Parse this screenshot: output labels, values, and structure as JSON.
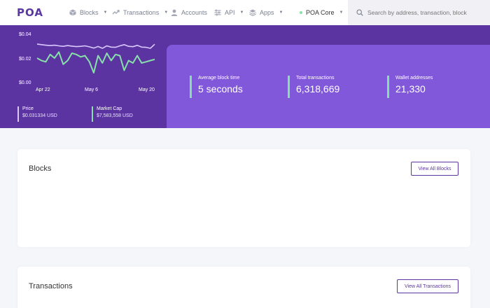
{
  "nav": {
    "logo": "POA",
    "items": [
      {
        "label": "Blocks",
        "has_caret": true
      },
      {
        "label": "Transactions",
        "has_caret": true
      },
      {
        "label": "Accounts",
        "has_caret": false
      },
      {
        "label": "API",
        "has_caret": true
      },
      {
        "label": "Apps",
        "has_caret": true
      }
    ],
    "network": "POA Core",
    "search_placeholder": "Search by address, transaction, block"
  },
  "chart": {
    "y_ticks": [
      "$0.04",
      "$0.02",
      "$0.00"
    ],
    "x_ticks": [
      "Apr 22",
      "May 6",
      "May 20"
    ],
    "series": [
      {
        "color": "#d8c9ff",
        "values": [
          0.0315,
          0.031,
          0.0305,
          0.0302,
          0.0305,
          0.03,
          0.0296,
          0.0302,
          0.0298,
          0.0294,
          0.0296,
          0.03,
          0.0292,
          0.0282,
          0.0295,
          0.028,
          0.03,
          0.029,
          0.0288,
          0.03,
          0.031,
          0.0296,
          0.0293,
          0.0304,
          0.029,
          0.0288,
          0.028,
          0.0313
        ]
      },
      {
        "color": "#87e1a9",
        "values": [
          0.02,
          0.018,
          0.017,
          0.023,
          0.02,
          0.025,
          0.015,
          0.018,
          0.024,
          0.023,
          0.021,
          0.022,
          0.017,
          0.008,
          0.022,
          0.016,
          0.024,
          0.018,
          0.023,
          0.022,
          0.01,
          0.018,
          0.016,
          0.022,
          0.016,
          0.017,
          0.018,
          0.019
        ]
      }
    ]
  },
  "market": {
    "price_label": "Price",
    "price_value": "$0.031334 USD",
    "cap_label": "Market Cap",
    "cap_value": "$7,583,558 USD"
  },
  "stats": [
    {
      "label": "Average block time",
      "value": "5 seconds"
    },
    {
      "label": "Total transactions",
      "value": "6,318,669"
    },
    {
      "label": "Wallet addresses",
      "value": "21,330"
    }
  ],
  "blocks_card": {
    "title": "Blocks",
    "button": "View All Blocks"
  },
  "tx_card": {
    "title": "Transactions",
    "button": "View All Transactions"
  },
  "colors": {
    "brand": "#5c34a2",
    "panel": "#8258db",
    "accent": "#87e1a9"
  }
}
